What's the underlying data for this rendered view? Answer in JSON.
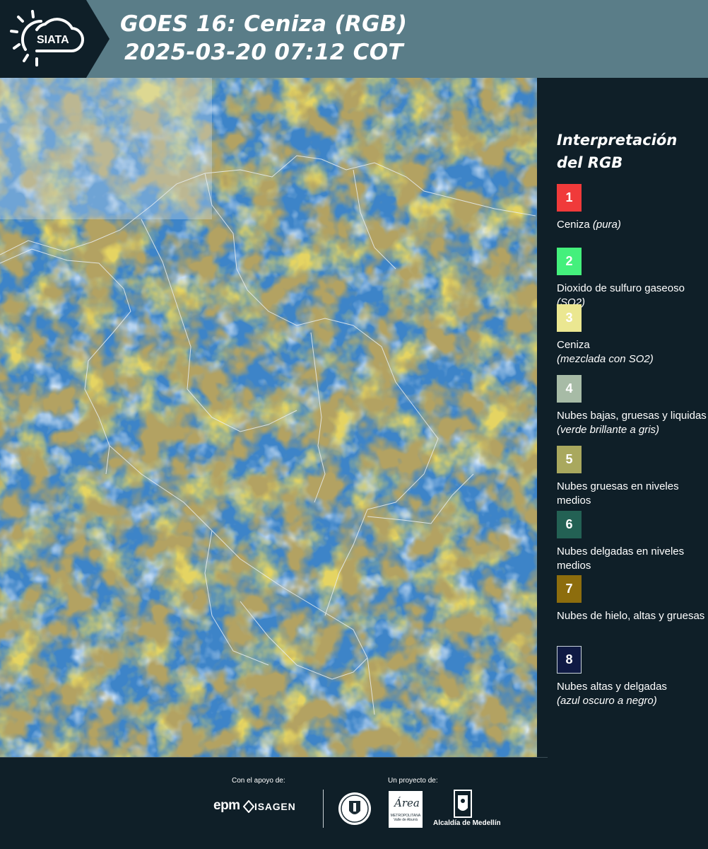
{
  "header": {
    "logo_text": "SIATA",
    "title_line1": "GOES 16: Ceniza (RGB)",
    "title_line2": "2025-03-20 07:12 COT"
  },
  "legend": {
    "title_line1": "Interpretación",
    "title_line2": "del RGB",
    "items": [
      {
        "number": "1",
        "color": "#f03a3a",
        "text": "Ceniza",
        "note": "(pura)"
      },
      {
        "number": "2",
        "color": "#44f07c",
        "text": "Dioxido de sulfuro gaseoso",
        "note": "(SO2)"
      },
      {
        "number": "3",
        "color": "#ebe791",
        "text": "Ceniza",
        "note": "(mezclada con SO2)"
      },
      {
        "number": "4",
        "color": "#a7bba6",
        "text": "Nubes bajas, gruesas y liquidas",
        "note": "(verde brillante a gris)"
      },
      {
        "number": "5",
        "color": "#a9a85e",
        "text": "Nubes gruesas en niveles medios",
        "note": ""
      },
      {
        "number": "6",
        "color": "#236154",
        "text": "Nubes delgadas en niveles medios",
        "note": ""
      },
      {
        "number": "7",
        "color": "#8d6d0d",
        "text": "Nubes de hielo, altas y gruesas",
        "note": ""
      },
      {
        "number": "8",
        "color": "#0f1a44",
        "text": "Nubes altas y delgadas",
        "note": "(azul oscuro a negro)"
      }
    ]
  },
  "footer": {
    "support_label": "Con el apoyo de:",
    "project_label": "Un proyecto de:",
    "sponsor1": "epm",
    "sponsor2": "ISAGEN",
    "area_word": "Área",
    "area_sub": "METROPOLITANA Valle de Aburrá",
    "alcaldia": "Alcaldía de Medellín"
  }
}
